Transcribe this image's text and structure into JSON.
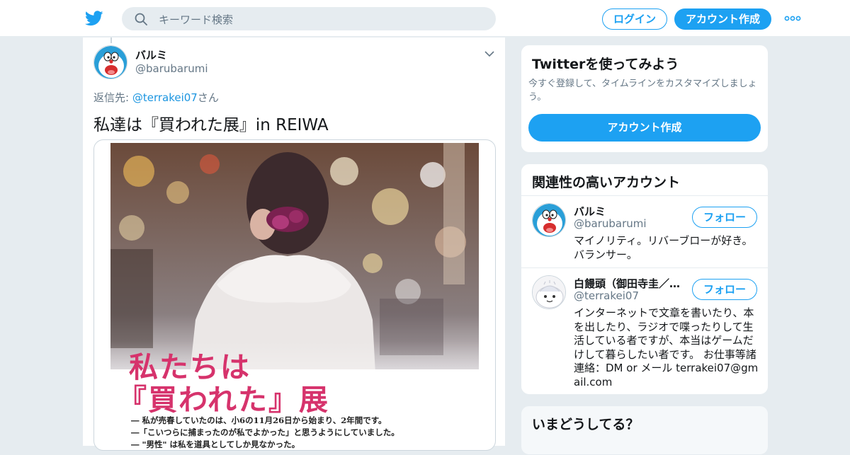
{
  "header": {
    "search_placeholder": "キーワード検索",
    "login_label": "ログイン",
    "signup_label": "アカウント作成"
  },
  "tweet": {
    "author_name": "バルミ",
    "author_handle": "@barubarumi",
    "reply_prefix": "返信先: ",
    "reply_handle": "@terrakei07",
    "reply_suffix": "さん",
    "text": "私達は『買われた展』in REIWA",
    "poster": {
      "title_line1": "私たちは",
      "title_line2": "『買われた』展",
      "lines": [
        "― 私が売春していたのは、小6の11月26日から始まり、2年間です。",
        "―「こいつらに捕まったのが私でよかった」と思うようにしていました。",
        "― \"男性\" は私を道具としてしか見なかった。"
      ]
    }
  },
  "sidebar": {
    "signup_card": {
      "title": "Twitterを使ってみよう",
      "description": "今すぐ登録して、タイムラインをカスタマイズしましょう。",
      "button": "アカウント作成"
    },
    "related": {
      "title": "関連性の高いアカウント",
      "accounts": [
        {
          "name": "バルミ",
          "handle": "@barubarumi",
          "follow": "フォロー",
          "bio": "マイノリティ。リバーブローが好き。バランサー。"
        },
        {
          "name": "白饅頭（御田寺圭／…",
          "handle": "@terrakei07",
          "follow": "フォロー",
          "bio": "インターネットで文章を書いたり、本を出したり、ラジオで喋ったりして生活している者ですが、本当はゲームだけして暮らしたい者です。 お仕事等諸連絡：DM or メール terrakei07@gmail.com"
        }
      ]
    },
    "trends": {
      "title": "いまどうしてる？"
    }
  },
  "colors": {
    "brand_blue": "#1da1f2",
    "link_blue": "#1b95e0",
    "muted_text": "#657786",
    "poster_pink": "#d6336c",
    "page_bg": "#e6ecf0"
  },
  "icons": [
    "twitter-bird-icon",
    "search-icon",
    "more-icon",
    "chevron-down-icon"
  ]
}
